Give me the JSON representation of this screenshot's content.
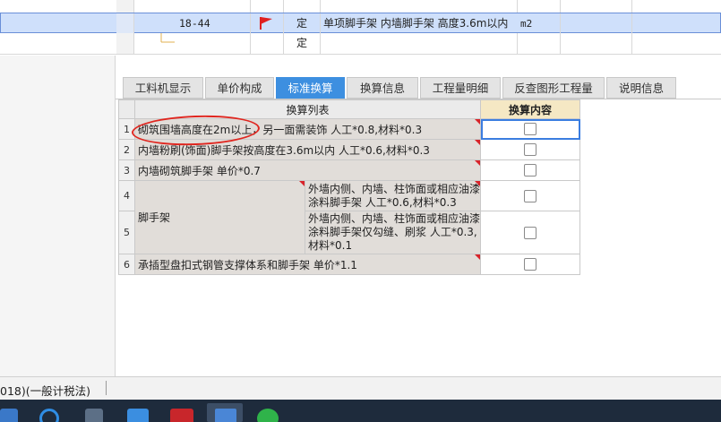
{
  "top_grid": {
    "row_partial": {
      "text": ""
    },
    "row_selected": {
      "code": "18-44",
      "type": "定",
      "name": "单项脚手架 内墙脚手架 高度3.6m以内",
      "unit": "m2"
    },
    "row_empty": {
      "type": "定"
    }
  },
  "tabs": [
    {
      "label": "工料机显示"
    },
    {
      "label": "单价构成"
    },
    {
      "label": "标准换算"
    },
    {
      "label": "换算信息"
    },
    {
      "label": "工程量明细"
    },
    {
      "label": "反查图形工程量"
    },
    {
      "label": "说明信息"
    }
  ],
  "active_tab": "标准换算",
  "table": {
    "header_list": "换算列表",
    "header_content": "换算内容",
    "rows": [
      {
        "num": "1",
        "text": "砌筑围墙高度在2m以上，另一面需装饰 人工*0.8,材料*0.3"
      },
      {
        "num": "2",
        "text": "内墙粉刷(饰面)脚手架按高度在3.6m以内 人工*0.6,材料*0.3"
      },
      {
        "num": "3",
        "text": "内墙砌筑脚手架 单价*0.7"
      },
      {
        "num": "4",
        "text": "外墙内侧、内墙、柱饰面或相应油漆涂料脚手架 人工*0.6,材料*0.3"
      },
      {
        "num": "5",
        "text": "外墙内侧、内墙、柱饰面或相应油漆涂料脚手架仅勾缝、刷浆 人工*0.3,材料*0.1"
      },
      {
        "num": "6",
        "text": "承插型盘扣式钢管支撑体系和脚手架 单价*1.1"
      }
    ],
    "group_label": "脚手架"
  },
  "status": {
    "text": "018)(一般计税法)"
  },
  "colors": {
    "accent": "#3d8fe0",
    "annotation": "#e0261f",
    "flag": "#e02020"
  }
}
